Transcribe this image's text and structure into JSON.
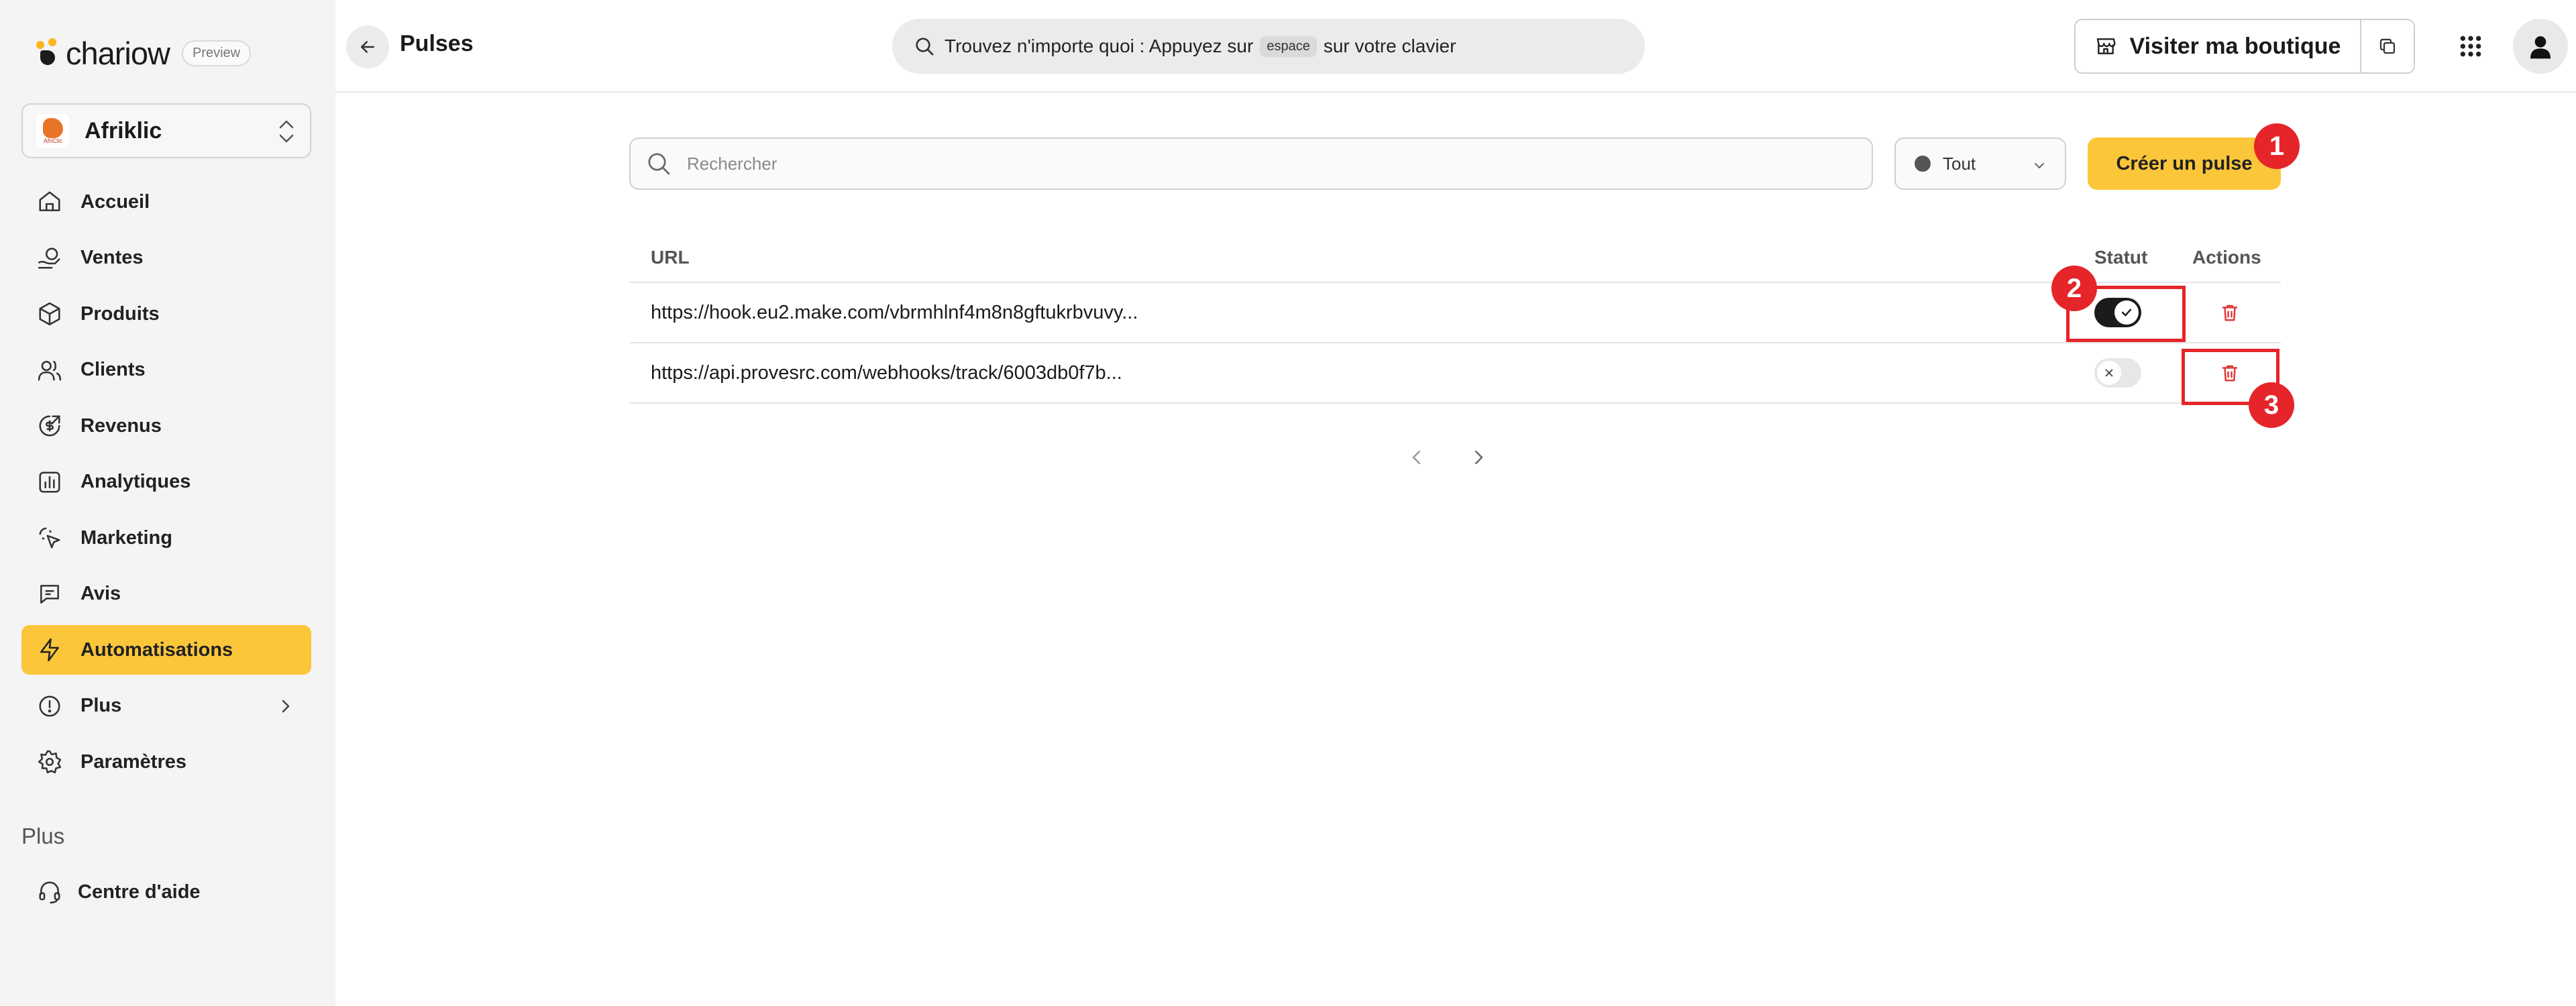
{
  "brand": {
    "name": "chariow",
    "badge": "Preview"
  },
  "store": {
    "name": "Afriklic",
    "avatar_text": "AfriClic"
  },
  "sidebar": {
    "items": [
      {
        "label": "Accueil",
        "icon": "home-icon"
      },
      {
        "label": "Ventes",
        "icon": "sales-icon"
      },
      {
        "label": "Produits",
        "icon": "box-icon"
      },
      {
        "label": "Clients",
        "icon": "users-icon"
      },
      {
        "label": "Revenus",
        "icon": "revenue-icon"
      },
      {
        "label": "Analytiques",
        "icon": "analytics-icon"
      },
      {
        "label": "Marketing",
        "icon": "cursor-icon"
      },
      {
        "label": "Avis",
        "icon": "comment-icon"
      },
      {
        "label": "Automatisations",
        "icon": "bolt-icon",
        "active": true
      },
      {
        "label": "Plus",
        "icon": "info-icon"
      },
      {
        "label": "Paramètres",
        "icon": "gear-icon"
      }
    ],
    "more_heading": "Plus",
    "help_label": "Centre d'aide"
  },
  "header": {
    "title": "Pulses",
    "search_prefix": "Trouvez n'importe quoi : Appuyez sur",
    "search_key": "espace",
    "search_suffix": "sur votre clavier",
    "shop_button": "Visiter ma boutique"
  },
  "toolbar": {
    "search_placeholder": "Rechercher",
    "filter_value": "Tout",
    "create_button": "Créer un pulse"
  },
  "table": {
    "columns": {
      "url": "URL",
      "status": "Statut",
      "actions": "Actions"
    },
    "rows": [
      {
        "url": "https://hook.eu2.make.com/vbrmhlnf4m8n8gftukrbvuvy...",
        "status": "on"
      },
      {
        "url": "https://api.provesrc.com/webhooks/track/6003db0f7b...",
        "status": "off"
      }
    ]
  },
  "annotations": [
    "1",
    "2",
    "3"
  ],
  "colors": {
    "accent": "#fcc63a",
    "annotation": "#e5252a",
    "delete": "#e03a3a"
  }
}
